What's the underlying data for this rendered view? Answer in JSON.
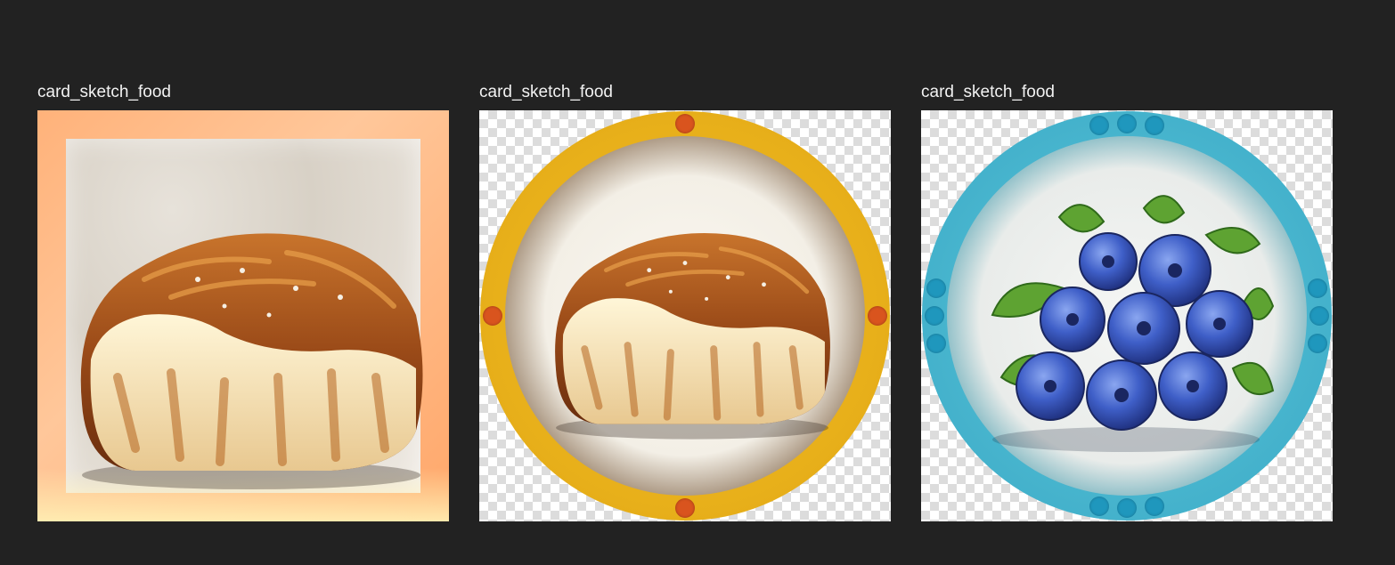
{
  "assets": [
    {
      "label": "card_sketch_food",
      "frame": "square-orange",
      "subject": "bread-icon"
    },
    {
      "label": "card_sketch_food",
      "frame": "round-gold",
      "subject": "bread-icon"
    },
    {
      "label": "card_sketch_food",
      "frame": "round-blue",
      "subject": "blueberries-icon"
    }
  ],
  "colors": {
    "background": "#222222",
    "label_text": "#f2f2f2",
    "orange_frame": "#ffb27a",
    "gold_frame": "#e8b01a",
    "gold_dots": "#d9541e",
    "blue_frame": "#4ab8d1",
    "blue_dots": "#1f97bd"
  }
}
